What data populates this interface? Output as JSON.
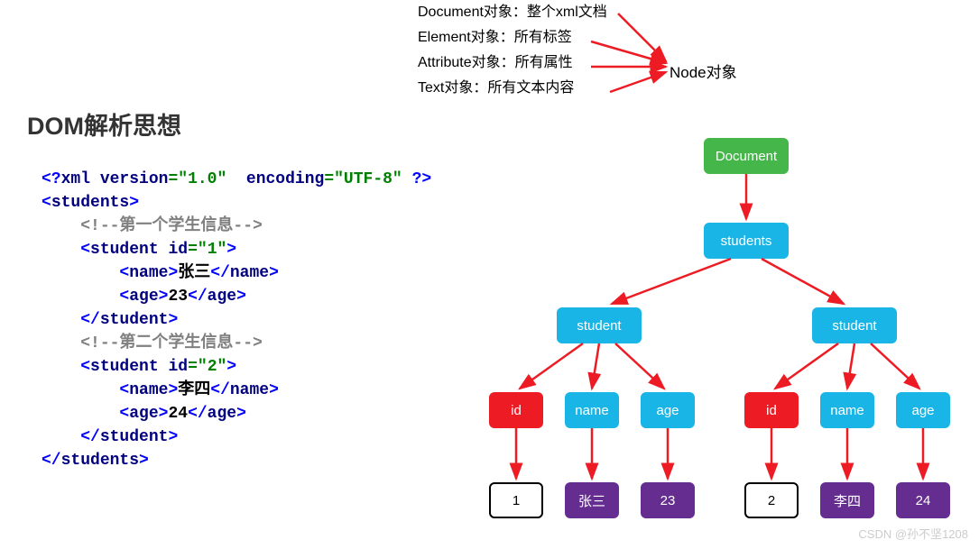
{
  "top_defs": {
    "doc": "Document对象：整个xml文档",
    "elem": "Element对象：所有标签",
    "attr": "Attribute对象：所有属性",
    "text": "Text对象：所有文本内容",
    "node": "Node对象"
  },
  "title": "DOM解析思想",
  "code": {
    "decl_open": "<?",
    "decl_xml": "xml",
    "decl_version_attr": "version",
    "decl_eq": "=",
    "decl_version_val": "\"1.0\"",
    "decl_encoding_attr": "encoding",
    "decl_encoding_val": "\"UTF-8\"",
    "decl_close": "?>",
    "students_open_lt": "<",
    "students": "students",
    "gt": ">",
    "close_lt": "</",
    "comment1": "<!--第一个学生信息-->",
    "student": "student",
    "id_attr": "id",
    "id_eq": "=",
    "id1": "\"1\"",
    "id2": "\"2\"",
    "name": "name",
    "name1": "张三",
    "name2": "李四",
    "age": "age",
    "age1": "23",
    "age2": "24",
    "comment2": "<!--第二个学生信息-->"
  },
  "tree": {
    "root": "Document",
    "l1": "students",
    "l2": "student",
    "id": "id",
    "name": "name",
    "age": "age",
    "v_id1": "1",
    "v_name1": "张三",
    "v_age1": "23",
    "v_id2": "2",
    "v_name2": "李四",
    "v_age2": "24"
  },
  "watermark": "CSDN @孙不坚1208",
  "chart_data": {
    "type": "tree",
    "title": "DOM解析思想",
    "definitions": [
      "Document对象：整个xml文档",
      "Element对象：所有标签",
      "Attribute对象：所有属性",
      "Text对象：所有文本内容"
    ],
    "parent_of_all": "Node对象",
    "nodes": [
      {
        "id": "doc",
        "label": "Document",
        "kind": "Document",
        "color": "green"
      },
      {
        "id": "students",
        "label": "students",
        "kind": "Element",
        "color": "blue",
        "parent": "doc"
      },
      {
        "id": "student1",
        "label": "student",
        "kind": "Element",
        "color": "blue",
        "parent": "students"
      },
      {
        "id": "student2",
        "label": "student",
        "kind": "Element",
        "color": "blue",
        "parent": "students"
      },
      {
        "id": "s1_id",
        "label": "id",
        "kind": "Attribute",
        "color": "red",
        "parent": "student1"
      },
      {
        "id": "s1_name",
        "label": "name",
        "kind": "Element",
        "color": "blue",
        "parent": "student1"
      },
      {
        "id": "s1_age",
        "label": "age",
        "kind": "Element",
        "color": "blue",
        "parent": "student1"
      },
      {
        "id": "s2_id",
        "label": "id",
        "kind": "Attribute",
        "color": "red",
        "parent": "student2"
      },
      {
        "id": "s2_name",
        "label": "name",
        "kind": "Element",
        "color": "blue",
        "parent": "student2"
      },
      {
        "id": "s2_age",
        "label": "age",
        "kind": "Element",
        "color": "blue",
        "parent": "student2"
      },
      {
        "id": "s1_id_v",
        "label": "1",
        "kind": "Text",
        "color": "white",
        "parent": "s1_id"
      },
      {
        "id": "s1_name_v",
        "label": "张三",
        "kind": "Text",
        "color": "purple",
        "parent": "s1_name"
      },
      {
        "id": "s1_age_v",
        "label": "23",
        "kind": "Text",
        "color": "purple",
        "parent": "s1_age"
      },
      {
        "id": "s2_id_v",
        "label": "2",
        "kind": "Text",
        "color": "white",
        "parent": "s2_id"
      },
      {
        "id": "s2_name_v",
        "label": "李四",
        "kind": "Text",
        "color": "purple",
        "parent": "s2_name"
      },
      {
        "id": "s2_age_v",
        "label": "24",
        "kind": "Text",
        "color": "purple",
        "parent": "s2_age"
      }
    ],
    "xml_source": "<?xml version=\"1.0\" encoding=\"UTF-8\" ?>\n<students>\n    <!--第一个学生信息-->\n    <student id=\"1\">\n        <name>张三</name>\n        <age>23</age>\n    </student>\n    <!--第二个学生信息-->\n    <student id=\"2\">\n        <name>李四</name>\n        <age>24</age>\n    </student>\n</students>"
  }
}
